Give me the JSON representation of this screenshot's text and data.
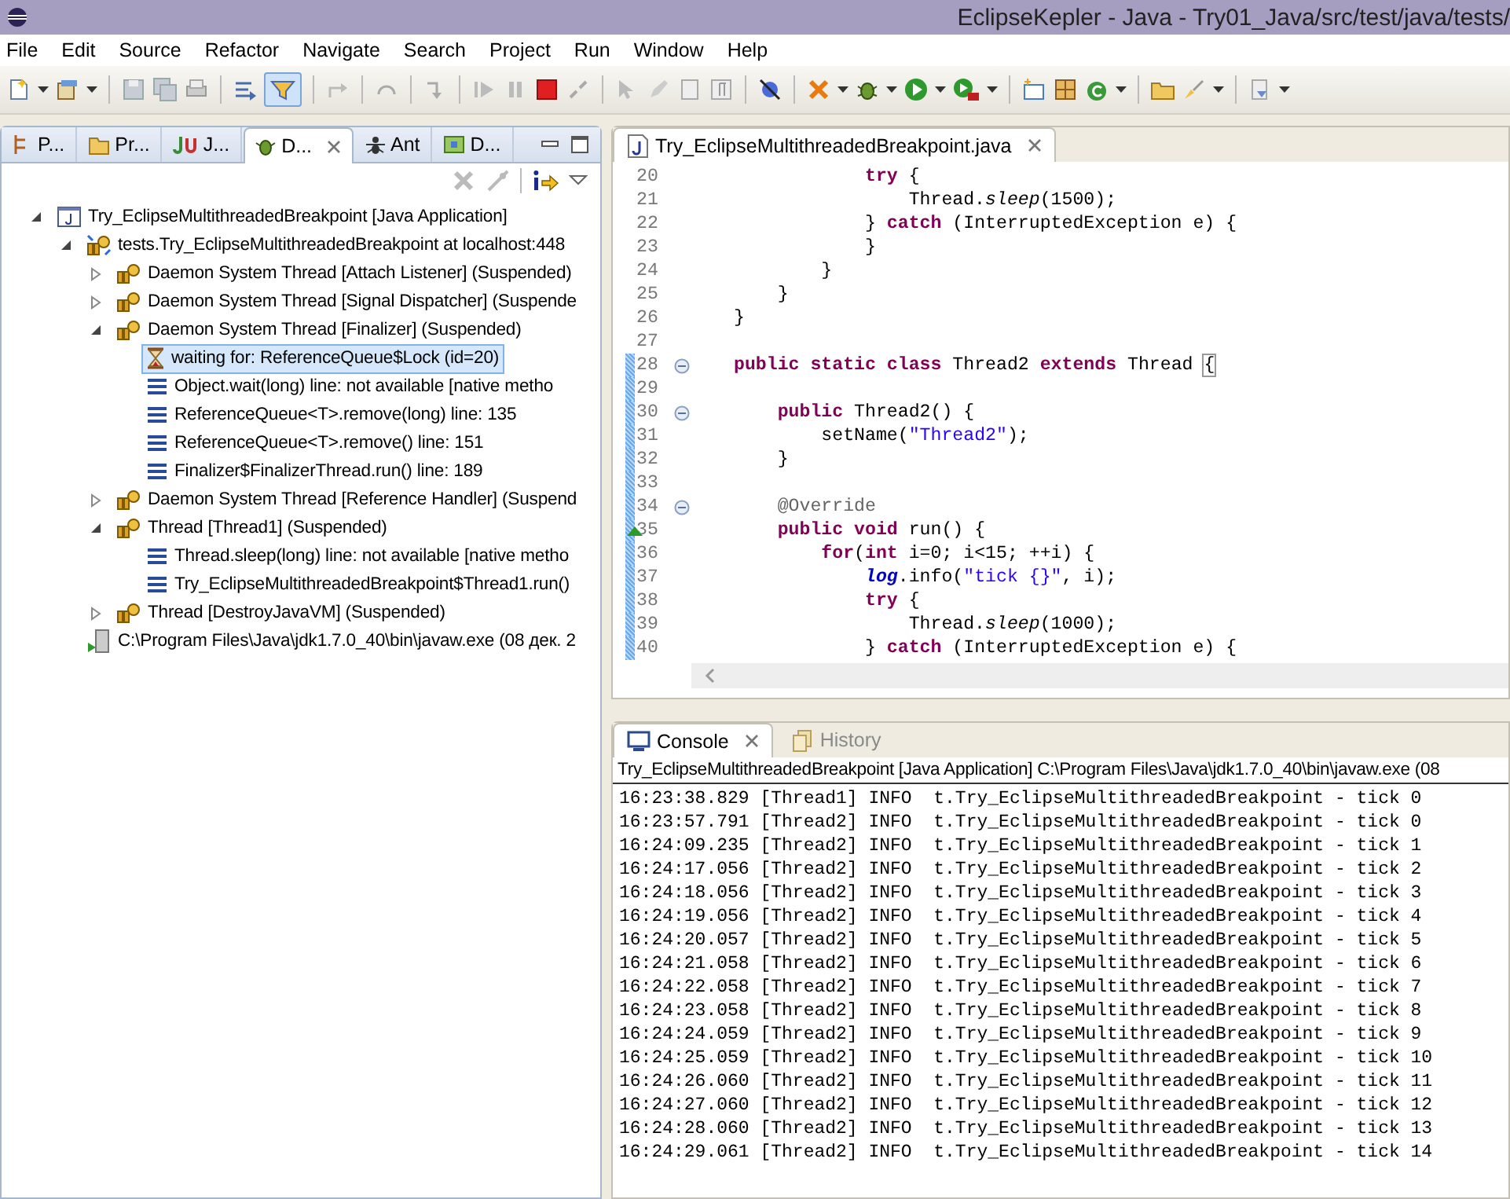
{
  "window": {
    "title": "EclipseKepler - Java - Try01_Java/src/test/java/tests/"
  },
  "menu": [
    "File",
    "Edit",
    "Source",
    "Refactor",
    "Navigate",
    "Search",
    "Project",
    "Run",
    "Window",
    "Help"
  ],
  "left_panel": {
    "tabs": [
      {
        "label": "P...",
        "kind": "hierarchy",
        "selected": false
      },
      {
        "label": "Pr...",
        "kind": "folder",
        "selected": false
      },
      {
        "label": "J...",
        "kind": "junit",
        "selected": false
      },
      {
        "label": "D...",
        "kind": "bug",
        "selected": true
      },
      {
        "label": "Ant",
        "kind": "ant",
        "selected": false
      },
      {
        "label": "D...",
        "kind": "map",
        "selected": false
      }
    ],
    "tree": [
      {
        "label": "Try_EclipseMultithreadedBreakpoint [Java Application]",
        "kind": "launch",
        "expanded": true,
        "selected": false,
        "children": [
          {
            "label": "tests.Try_EclipseMultithreadedBreakpoint at localhost:448",
            "kind": "target",
            "expanded": true,
            "selected": false,
            "children": [
              {
                "label": "Daemon System Thread [Attach Listener] (Suspended)",
                "kind": "thread",
                "expanded": false,
                "selected": false
              },
              {
                "label": "Daemon System Thread [Signal Dispatcher] (Suspende",
                "kind": "thread",
                "expanded": false,
                "selected": false
              },
              {
                "label": "Daemon System Thread [Finalizer] (Suspended)",
                "kind": "thread",
                "expanded": true,
                "selected": false,
                "children": [
                  {
                    "label": "waiting for: ReferenceQueue$Lock  (id=20)",
                    "kind": "monitor",
                    "selected": true
                  },
                  {
                    "label": "Object.wait(long) line: not available [native metho",
                    "kind": "frame",
                    "selected": false
                  },
                  {
                    "label": "ReferenceQueue<T>.remove(long) line: 135",
                    "kind": "frame",
                    "selected": false
                  },
                  {
                    "label": "ReferenceQueue<T>.remove() line: 151",
                    "kind": "frame",
                    "selected": false
                  },
                  {
                    "label": "Finalizer$FinalizerThread.run() line: 189",
                    "kind": "frame",
                    "selected": false
                  }
                ]
              },
              {
                "label": "Daemon System Thread [Reference Handler] (Suspend",
                "kind": "thread",
                "expanded": false,
                "selected": false
              },
              {
                "label": "Thread [Thread1] (Suspended)",
                "kind": "thread",
                "expanded": true,
                "selected": false,
                "children": [
                  {
                    "label": "Thread.sleep(long) line: not available [native metho",
                    "kind": "frame",
                    "selected": false
                  },
                  {
                    "label": "Try_EclipseMultithreadedBreakpoint$Thread1.run()",
                    "kind": "frame",
                    "selected": false
                  }
                ]
              },
              {
                "label": "Thread [DestroyJavaVM] (Suspended)",
                "kind": "thread",
                "expanded": false,
                "selected": false
              }
            ]
          },
          {
            "label": "C:\\Program Files\\Java\\jdk1.7.0_40\\bin\\javaw.exe (08 дек. 2",
            "kind": "process",
            "selected": false
          }
        ]
      }
    ]
  },
  "editor": {
    "tab": {
      "label": "Try_EclipseMultithreadedBreakpoint.java",
      "selected": true
    },
    "lines": [
      {
        "number": "20",
        "fold": false,
        "diff": false,
        "override": false,
        "tokens": [
          {
            "text": "            try",
            "kind": "keyword"
          },
          {
            "text": " {",
            "kind": "plain"
          }
        ]
      },
      {
        "number": "21",
        "fold": false,
        "diff": false,
        "override": false,
        "tokens": [
          {
            "text": "                Thread.",
            "kind": "plain"
          },
          {
            "text": "sleep",
            "kind": "static"
          },
          {
            "text": "(1500);",
            "kind": "plain"
          }
        ]
      },
      {
        "number": "22",
        "fold": false,
        "diff": false,
        "override": false,
        "tokens": [
          {
            "text": "            } ",
            "kind": "plain"
          },
          {
            "text": "catch",
            "kind": "keyword"
          },
          {
            "text": " (InterruptedException e) {",
            "kind": "plain"
          }
        ]
      },
      {
        "number": "23",
        "fold": false,
        "diff": false,
        "override": false,
        "tokens": [
          {
            "text": "            }",
            "kind": "plain"
          }
        ]
      },
      {
        "number": "24",
        "fold": false,
        "diff": false,
        "override": false,
        "tokens": [
          {
            "text": "        }",
            "kind": "plain"
          }
        ]
      },
      {
        "number": "25",
        "fold": false,
        "diff": false,
        "override": false,
        "tokens": [
          {
            "text": "    }",
            "kind": "plain"
          }
        ]
      },
      {
        "number": "26",
        "fold": false,
        "diff": false,
        "override": false,
        "tokens": [
          {
            "text": "}",
            "kind": "plain"
          }
        ]
      },
      {
        "number": "27",
        "fold": false,
        "diff": false,
        "override": false
      },
      {
        "number": "28",
        "fold": true,
        "diff": true,
        "override": false,
        "tokens": [
          {
            "text": "public static class",
            "kind": "keyword"
          },
          {
            "text": " Thread2 ",
            "kind": "plain"
          },
          {
            "text": "extends",
            "kind": "keyword"
          },
          {
            "text": " Thread ",
            "kind": "plain"
          },
          {
            "text": "{",
            "kind": "match"
          }
        ]
      },
      {
        "number": "29",
        "fold": false,
        "diff": true,
        "override": false
      },
      {
        "number": "30",
        "fold": true,
        "diff": true,
        "override": false,
        "tokens": [
          {
            "text": "    public",
            "kind": "keyword"
          },
          {
            "text": " Thread2() {",
            "kind": "plain"
          }
        ]
      },
      {
        "number": "31",
        "fold": false,
        "diff": true,
        "override": false,
        "tokens": [
          {
            "text": "        setName(",
            "kind": "plain"
          },
          {
            "text": "\"Thread2\"",
            "kind": "string"
          },
          {
            "text": ");",
            "kind": "plain"
          }
        ]
      },
      {
        "number": "32",
        "fold": false,
        "diff": true,
        "override": false,
        "tokens": [
          {
            "text": "    }",
            "kind": "plain"
          }
        ]
      },
      {
        "number": "33",
        "fold": false,
        "diff": true,
        "override": false
      },
      {
        "number": "34",
        "fold": true,
        "diff": true,
        "override": false,
        "tokens": [
          {
            "text": "    @Override",
            "kind": "annotation"
          }
        ]
      },
      {
        "number": "35",
        "fold": false,
        "diff": true,
        "override": true,
        "tokens": [
          {
            "text": "    public void",
            "kind": "keyword"
          },
          {
            "text": " run() {",
            "kind": "plain"
          }
        ]
      },
      {
        "number": "36",
        "fold": false,
        "diff": true,
        "override": false,
        "tokens": [
          {
            "text": "        for",
            "kind": "keyword"
          },
          {
            "text": "(",
            "kind": "plain"
          },
          {
            "text": "int",
            "kind": "keyword"
          },
          {
            "text": " i=0; i<15; ++i) {",
            "kind": "plain"
          }
        ]
      },
      {
        "number": "37",
        "fold": false,
        "diff": true,
        "override": false,
        "tokens": [
          {
            "text": "            log",
            "kind": "field"
          },
          {
            "text": ".info(",
            "kind": "plain"
          },
          {
            "text": "\"tick {}\"",
            "kind": "string"
          },
          {
            "text": ", i);",
            "kind": "plain"
          }
        ]
      },
      {
        "number": "38",
        "fold": false,
        "diff": true,
        "override": false,
        "tokens": [
          {
            "text": "            try",
            "kind": "keyword"
          },
          {
            "text": " {",
            "kind": "plain"
          }
        ]
      },
      {
        "number": "39",
        "fold": false,
        "diff": true,
        "override": false,
        "tokens": [
          {
            "text": "                Thread.",
            "kind": "plain"
          },
          {
            "text": "sleep",
            "kind": "static"
          },
          {
            "text": "(1000);",
            "kind": "plain"
          }
        ]
      },
      {
        "number": "40",
        "fold": false,
        "diff": true,
        "override": false,
        "tokens": [
          {
            "text": "            } ",
            "kind": "plain"
          },
          {
            "text": "catch",
            "kind": "keyword"
          },
          {
            "text": " (InterruptedException e) {",
            "kind": "plain"
          }
        ]
      }
    ]
  },
  "console": {
    "tabs": [
      {
        "label": "Console",
        "kind": "console",
        "selected": true,
        "disabled": false
      },
      {
        "label": "History",
        "kind": "history",
        "selected": false,
        "disabled": true
      }
    ],
    "header": "Try_EclipseMultithreadedBreakpoint [Java Application] C:\\Program Files\\Java\\jdk1.7.0_40\\bin\\javaw.exe (08",
    "lines": [
      "16:23:38.829 [Thread1] INFO  t.Try_EclipseMultithreadedBreakpoint - tick 0",
      "16:23:57.791 [Thread2] INFO  t.Try_EclipseMultithreadedBreakpoint - tick 0",
      "16:24:09.235 [Thread2] INFO  t.Try_EclipseMultithreadedBreakpoint - tick 1",
      "16:24:17.056 [Thread2] INFO  t.Try_EclipseMultithreadedBreakpoint - tick 2",
      "16:24:18.056 [Thread2] INFO  t.Try_EclipseMultithreadedBreakpoint - tick 3",
      "16:24:19.056 [Thread2] INFO  t.Try_EclipseMultithreadedBreakpoint - tick 4",
      "16:24:20.057 [Thread2] INFO  t.Try_EclipseMultithreadedBreakpoint - tick 5",
      "16:24:21.058 [Thread2] INFO  t.Try_EclipseMultithreadedBreakpoint - tick 6",
      "16:24:22.058 [Thread2] INFO  t.Try_EclipseMultithreadedBreakpoint - tick 7",
      "16:24:23.058 [Thread2] INFO  t.Try_EclipseMultithreadedBreakpoint - tick 8",
      "16:24:24.059 [Thread2] INFO  t.Try_EclipseMultithreadedBreakpoint - tick 9",
      "16:24:25.059 [Thread2] INFO  t.Try_EclipseMultithreadedBreakpoint - tick 10",
      "16:24:26.060 [Thread2] INFO  t.Try_EclipseMultithreadedBreakpoint - tick 11",
      "16:24:27.060 [Thread2] INFO  t.Try_EclipseMultithreadedBreakpoint - tick 12",
      "16:24:28.060 [Thread2] INFO  t.Try_EclipseMultithreadedBreakpoint - tick 13",
      "16:24:29.061 [Thread2] INFO  t.Try_EclipseMultithreadedBreakpoint - tick 14"
    ]
  }
}
